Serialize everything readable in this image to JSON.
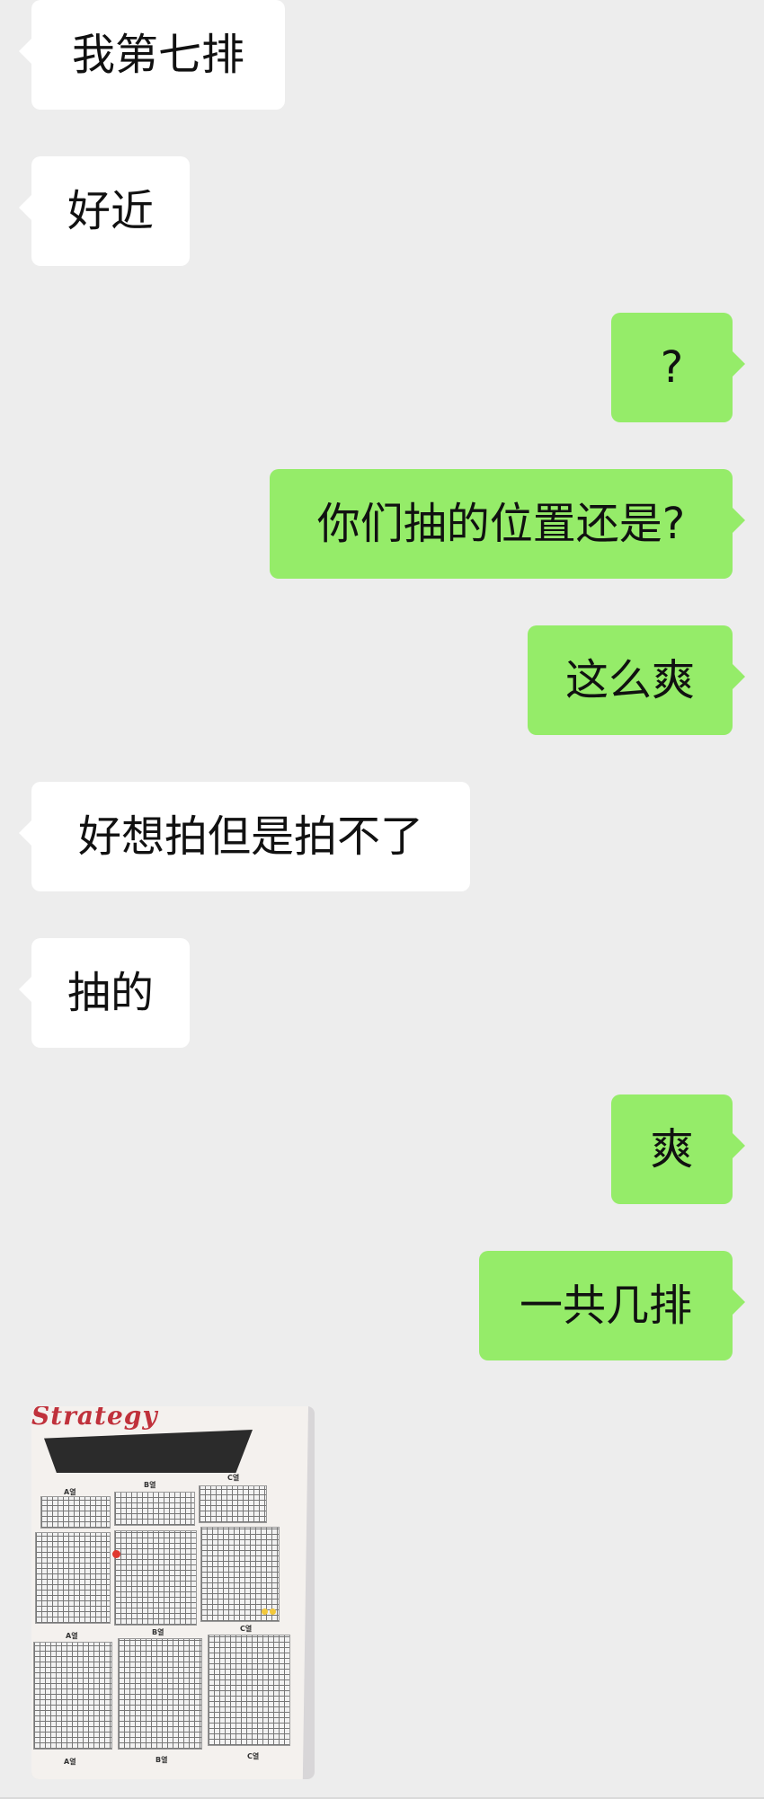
{
  "messages": [
    {
      "side": "left",
      "text": "我第七排"
    },
    {
      "side": "left",
      "text": "好近"
    },
    {
      "side": "right",
      "text": "?"
    },
    {
      "side": "right",
      "text": "你们抽的位置还是?"
    },
    {
      "side": "right",
      "text": "这么爽"
    },
    {
      "side": "left",
      "text": "好想拍但是拍不了"
    },
    {
      "side": "left",
      "text": "抽的"
    },
    {
      "side": "right",
      "text": "爽"
    },
    {
      "side": "right",
      "text": "一共几排"
    }
  ],
  "image_message": {
    "side": "left",
    "brand_text": "Strategy",
    "section_labels": [
      "A열",
      "B열",
      "C열",
      "A열",
      "B열",
      "C열",
      "A열",
      "B열",
      "C열"
    ]
  },
  "colors": {
    "background": "#ededed",
    "left_bubble": "#ffffff",
    "right_bubble": "#95ec69"
  }
}
